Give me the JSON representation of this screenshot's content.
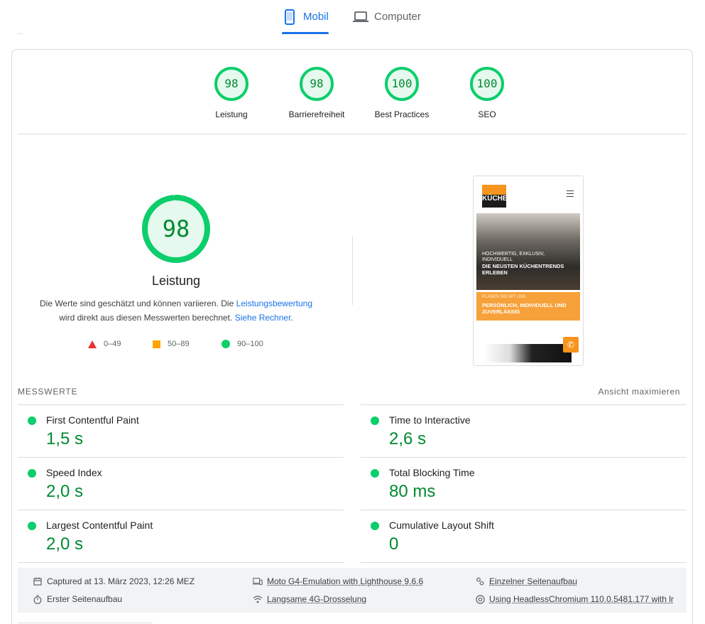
{
  "tabs": {
    "mobile": "Mobil",
    "desktop": "Computer"
  },
  "categories": [
    {
      "score": "98",
      "label": "Leistung",
      "value": 0.98
    },
    {
      "score": "98",
      "label": "Barrierefreiheit",
      "value": 0.98
    },
    {
      "score": "100",
      "label": "Best Practices",
      "value": 1.0
    },
    {
      "score": "100",
      "label": "SEO",
      "value": 1.0
    }
  ],
  "performance": {
    "score": "98",
    "label": "Leistung",
    "desc_pre": "Die Werte sind geschätzt und können variieren. Die ",
    "desc_link1": "Leistungsbewertung",
    "desc_mid": "wird direkt aus diesen Messwerten berechnet. ",
    "desc_link2": "Siehe Rechner",
    "desc_end": "."
  },
  "legend": {
    "fail": "0–49",
    "average": "50–89",
    "pass": "90–100"
  },
  "screenshot": {
    "logo_text": "KÜCHE",
    "hero_small": "HOCHWERTIG, EXKLUSIV, INDIVIDUELL",
    "hero_big": "DIE NEUSTEN KÜCHENTRENDS ERLEBEN",
    "orange_small": "PLANEN SIE MIT UNS",
    "orange_big": "PERSÖNLICH, INDIVIDUELL UND ZUVERLÄSSIG"
  },
  "metrics": {
    "header": "MESSWERTE",
    "toggle": "Ansicht maximieren",
    "fcp": {
      "title": "First Contentful Paint",
      "value": "1,5 s"
    },
    "tti": {
      "title": "Time to Interactive",
      "value": "2,6 s"
    },
    "si": {
      "title": "Speed Index",
      "value": "2,0 s"
    },
    "tbt": {
      "title": "Total Blocking Time",
      "value": "80 ms"
    },
    "lcp": {
      "title": "Largest Contentful Paint",
      "value": "2,0 s"
    },
    "cls": {
      "title": "Cumulative Layout Shift",
      "value": "0"
    }
  },
  "runtime": {
    "captured": "Captured at 13. März 2023, 12:26 MEZ",
    "initial": "Erster Seitenaufbau",
    "device": "Moto G4-Emulation with Lighthouse 9.6.6",
    "network": "Langsame 4G-Drosselung",
    "session": "Einzelner Seitenaufbau",
    "browser": "Using HeadlessChromium 110.0.5481.177 with lr"
  },
  "colors": {
    "pass": "#0cce6b",
    "pass_text": "#008a31",
    "average": "#ffa400",
    "fail": "#eb3333",
    "accent": "#1a73e8"
  }
}
